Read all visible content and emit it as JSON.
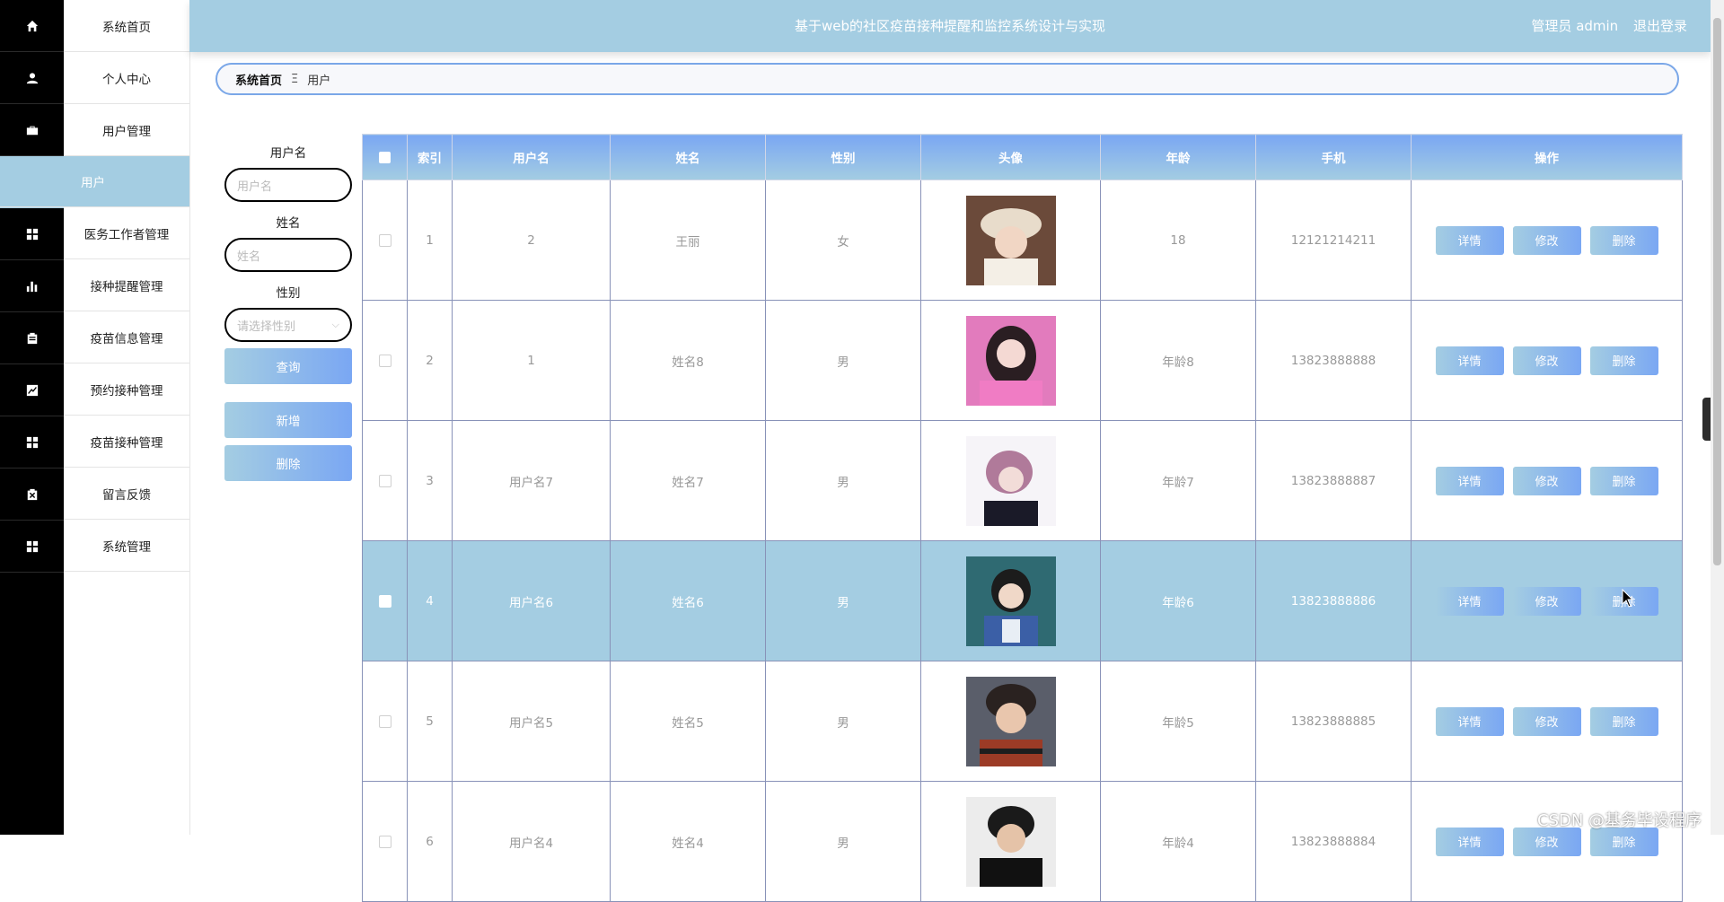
{
  "header": {
    "title": "基于web的社区疫苗接种提醒和监控系统设计与实现",
    "user_label": "管理员 admin",
    "logout_label": "退出登录"
  },
  "sidebar": {
    "items": [
      {
        "label": "系统首页",
        "icon": "home-icon"
      },
      {
        "label": "个人中心",
        "icon": "user-icon"
      },
      {
        "label": "用户管理",
        "icon": "briefcase-icon"
      },
      {
        "label": "用户",
        "icon": "",
        "active": true
      },
      {
        "label": "医务工作者管理",
        "icon": "grid-icon"
      },
      {
        "label": "接种提醒管理",
        "icon": "bar-chart-icon"
      },
      {
        "label": "疫苗信息管理",
        "icon": "clipboard-icon"
      },
      {
        "label": "预约接种管理",
        "icon": "trend-icon"
      },
      {
        "label": "疫苗接种管理",
        "icon": "grid-icon"
      },
      {
        "label": "留言反馈",
        "icon": "clipboard-x-icon"
      },
      {
        "label": "系统管理",
        "icon": "grid-icon"
      }
    ]
  },
  "breadcrumb": {
    "home": "系统首页",
    "separator": "Ξ",
    "current": "用户"
  },
  "search": {
    "username_label": "用户名",
    "username_placeholder": "用户名",
    "name_label": "姓名",
    "name_placeholder": "姓名",
    "gender_label": "性别",
    "gender_placeholder": "请选择性别",
    "query_button": "查询",
    "add_button": "新增",
    "delete_button": "删除"
  },
  "table": {
    "columns": [
      "索引",
      "用户名",
      "姓名",
      "性别",
      "头像",
      "年龄",
      "手机",
      "操作"
    ],
    "rows": [
      {
        "index": "1",
        "username": "2",
        "name": "王丽",
        "gender": "女",
        "age": "18",
        "phone": "12121214211"
      },
      {
        "index": "2",
        "username": "1",
        "name": "姓名8",
        "gender": "男",
        "age": "年龄8",
        "phone": "13823888888"
      },
      {
        "index": "3",
        "username": "用户名7",
        "name": "姓名7",
        "gender": "男",
        "age": "年龄7",
        "phone": "13823888887"
      },
      {
        "index": "4",
        "username": "用户名6",
        "name": "姓名6",
        "gender": "男",
        "age": "年龄6",
        "phone": "13823888886"
      },
      {
        "index": "5",
        "username": "用户名5",
        "name": "姓名5",
        "gender": "男",
        "age": "年龄5",
        "phone": "13823888885"
      },
      {
        "index": "6",
        "username": "用户名4",
        "name": "姓名4",
        "gender": "男",
        "age": "年龄4",
        "phone": "13823888884"
      }
    ],
    "actions": {
      "detail": "详情",
      "edit": "修改",
      "delete": "删除"
    }
  },
  "watermark": "CSDN @基务毕设程序",
  "colors": {
    "accent": "#a4cde2",
    "accent2": "#7aa7f3",
    "sidebar_bg": "#000000"
  }
}
